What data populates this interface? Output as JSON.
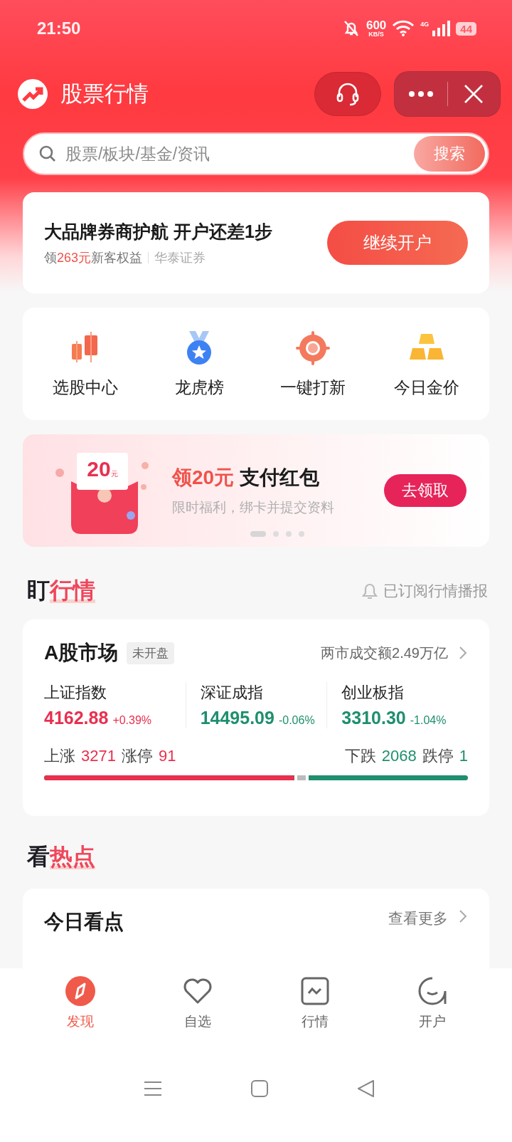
{
  "status_bar": {
    "time": "21:50",
    "speed_value": "600",
    "speed_unit": "KB/S",
    "network": "4G",
    "battery": "44"
  },
  "header": {
    "title": "股票行情"
  },
  "search": {
    "placeholder": "股票/板块/基金/资讯",
    "button": "搜索"
  },
  "account_card": {
    "title": "大品牌券商护航 开户还差1步",
    "benefit_prefix": "领",
    "benefit_amount": "263元",
    "benefit_suffix": "新客权益",
    "broker": "华泰证券",
    "button": "继续开户"
  },
  "shortcuts": [
    {
      "kind": "candles",
      "label": "选股中心"
    },
    {
      "kind": "medal",
      "label": "龙虎榜"
    },
    {
      "kind": "target",
      "label": "一键打新"
    },
    {
      "kind": "gold",
      "label": "今日金价"
    }
  ],
  "promo_banner": {
    "card_amount": "20",
    "card_unit": "元",
    "title_accent": "领20元",
    "title_rest": "支付红包",
    "subtitle": "限时福利，绑卡并提交资料",
    "button": "去领取",
    "dots": [
      {
        "selected": true
      },
      {
        "selected": false
      },
      {
        "selected": false
      },
      {
        "selected": false
      }
    ]
  },
  "market_section": {
    "title_lead": "盯",
    "title_accent": "行情",
    "subscribe": "已订阅行情播报"
  },
  "market_card": {
    "title": "A股市场",
    "status_tag": "未开盘",
    "turnover": "两市成交额2.49万亿",
    "indices": [
      {
        "name": "上证指数",
        "value": "4162.88",
        "change": "+0.39%",
        "kind": "up"
      },
      {
        "name": "深证成指",
        "value": "14495.09",
        "change": "-0.06%",
        "kind": "down"
      },
      {
        "name": "创业板指",
        "value": "3310.30",
        "change": "-1.04%",
        "kind": "down"
      }
    ],
    "rise_label": "上涨",
    "rise_count": "3271",
    "limit_up_label": "涨停",
    "limit_up_count": "91",
    "fall_label": "下跌",
    "fall_count": "2068",
    "limit_down_label": "跌停",
    "limit_down_count": "1",
    "breadth_bar": {
      "level": 0.59
    }
  },
  "hot_section": {
    "title_lead": "看",
    "title_accent": "热点"
  },
  "today_card": {
    "title": "今日看点",
    "more": "查看更多"
  },
  "bottom_nav": [
    {
      "kind": "compass",
      "label": "发现",
      "selected": true
    },
    {
      "kind": "heart",
      "label": "自选",
      "selected": false
    },
    {
      "kind": "chart",
      "label": "行情",
      "selected": false
    },
    {
      "kind": "chat",
      "label": "开户",
      "selected": false
    }
  ]
}
